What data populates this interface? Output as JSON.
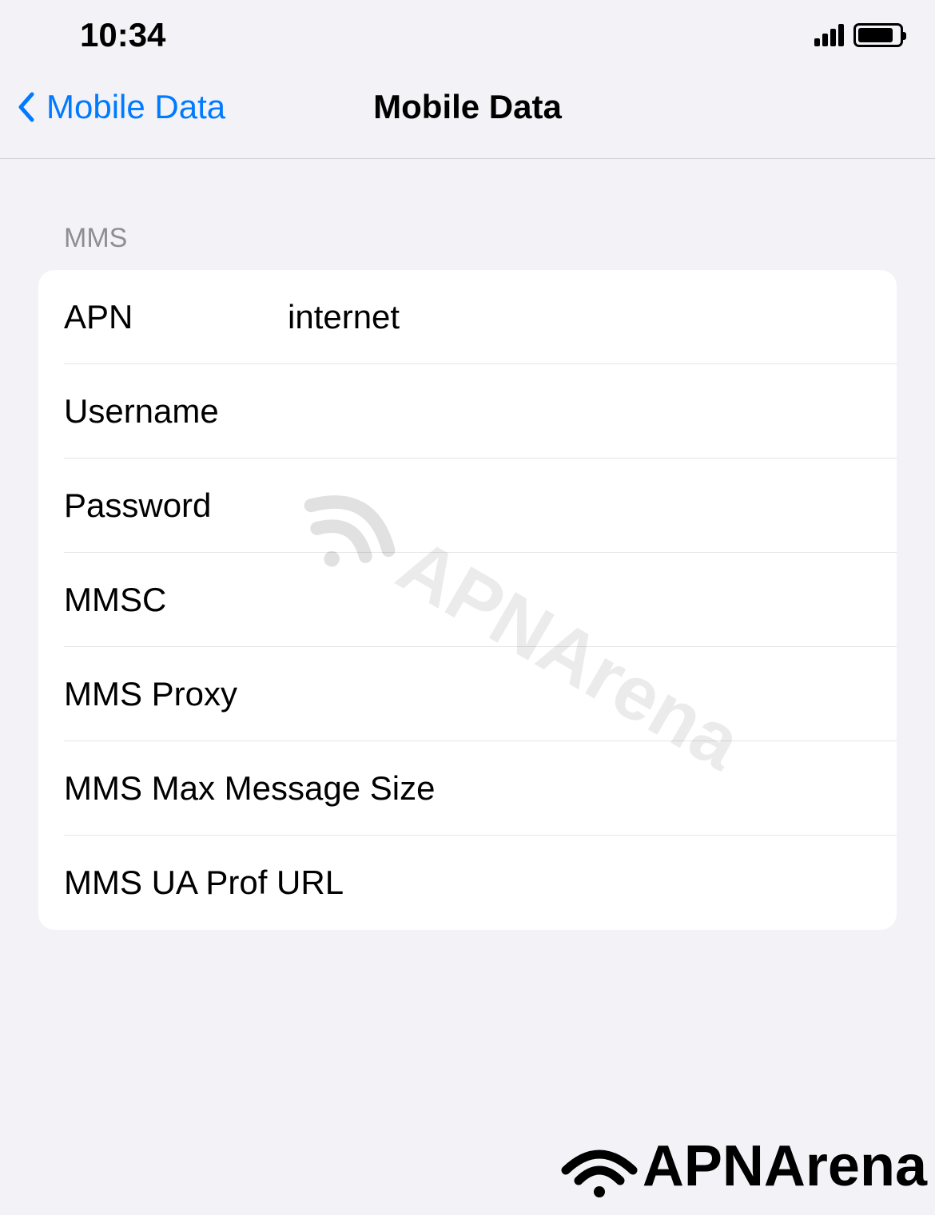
{
  "statusBar": {
    "time": "10:34"
  },
  "navBar": {
    "backLabel": "Mobile Data",
    "title": "Mobile Data"
  },
  "section": {
    "header": "MMS",
    "rows": [
      {
        "label": "APN",
        "value": "internet"
      },
      {
        "label": "Username",
        "value": ""
      },
      {
        "label": "Password",
        "value": ""
      },
      {
        "label": "MMSC",
        "value": ""
      },
      {
        "label": "MMS Proxy",
        "value": ""
      },
      {
        "label": "MMS Max Message Size",
        "value": ""
      },
      {
        "label": "MMS UA Prof URL",
        "value": ""
      }
    ]
  },
  "watermark": {
    "text": "APNArena"
  },
  "bottomLogo": {
    "text": "APNArena"
  }
}
